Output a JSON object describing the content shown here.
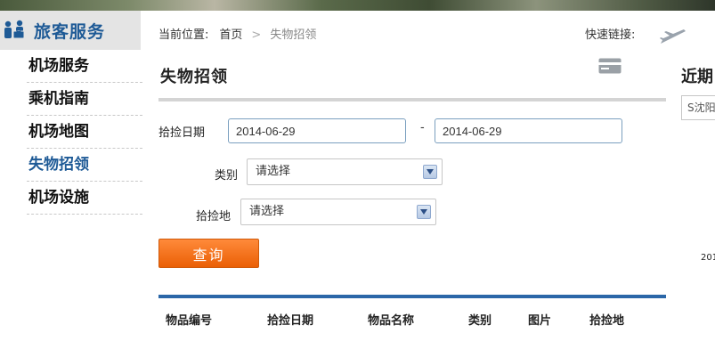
{
  "sidebar": {
    "title": "旅客服务",
    "icon": "passengers-icon",
    "items": [
      {
        "label": "机场服务",
        "active": false
      },
      {
        "label": "乘机指南",
        "active": false
      },
      {
        "label": "机场地图",
        "active": false
      },
      {
        "label": "失物招领",
        "active": true
      },
      {
        "label": "机场设施",
        "active": false
      }
    ]
  },
  "breadcrumb": {
    "prefix": "当前位置:",
    "home": "首页",
    "separator": ">",
    "current": "失物招领"
  },
  "quick_links": {
    "label": "快速链接:",
    "icon": "airplane-icon"
  },
  "page": {
    "title": "失物招领",
    "icon": "card-icon"
  },
  "form": {
    "date_label": "拾捡日期",
    "date_from": "2014-06-29",
    "date_to": "2014-06-29",
    "date_separator": "-",
    "category_label": "类别",
    "category_value": "请选择",
    "location_label": "拾捡地",
    "location_value": "请选择",
    "query_button": "查询"
  },
  "table": {
    "columns": [
      "物品编号",
      "拾捡日期",
      "物品名称",
      "类别",
      "图片",
      "拾捡地"
    ]
  },
  "recent": {
    "title": "近期",
    "select_value": "S沈阳",
    "year_text": "201"
  },
  "colors": {
    "accent": "#1e5a96",
    "button": "#ea5f05",
    "table_rule": "#2b67a8"
  }
}
